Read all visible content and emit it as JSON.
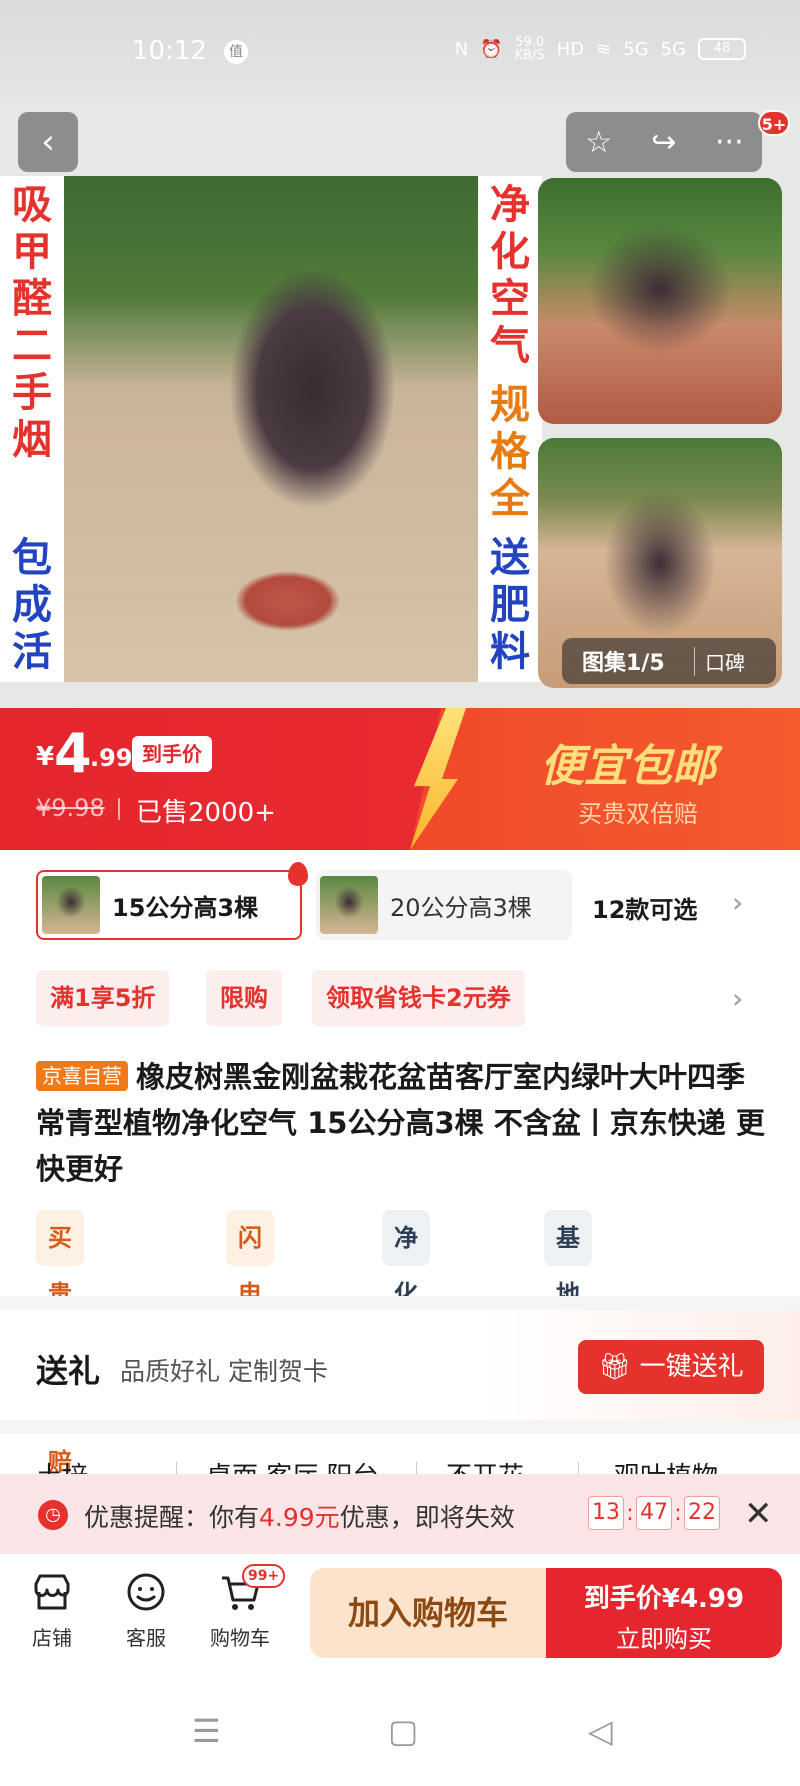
{
  "status_bar": {
    "time": "10:12",
    "app_badge": "值",
    "nfc": "N",
    "alarm": "⏰",
    "net_speed": "59.0\nKB/S",
    "hd": "HD",
    "wifi": "≋",
    "sig1": "5G",
    "sig2": "5G",
    "battery": "48"
  },
  "gallery": {
    "left_text_top": [
      "吸",
      "甲",
      "醛",
      "二",
      "手",
      "烟"
    ],
    "left_text_bottom": [
      "包",
      "成",
      "活"
    ],
    "right_text_top": [
      "净",
      "化",
      "空",
      "气"
    ],
    "right_text_mid": [
      "规",
      "格",
      "全"
    ],
    "right_text_bottom": [
      "送",
      "肥",
      "料"
    ],
    "counter": "图集1/5",
    "word_of_mouth": "口碑"
  },
  "nav": {
    "back": "‹",
    "star": "☆",
    "share": "↪",
    "more": "···",
    "badge": "5+"
  },
  "price": {
    "currency": "¥",
    "integer": "4",
    "decimal": ".99",
    "tag": "到手价",
    "original": "¥9.98",
    "sold": "已售2000+",
    "slogan": "便宜包邮",
    "slogan_sub": "买贵双倍赔"
  },
  "variants": {
    "items": [
      {
        "label": "15公分高3棵"
      },
      {
        "label": "20公分高3棵"
      }
    ],
    "more": "12款可选",
    "chevron": "›"
  },
  "promos": {
    "items": [
      "满1享5折",
      "限购",
      "领取省钱卡2元券"
    ],
    "chevron": "›"
  },
  "product": {
    "self_tag": "京喜自营",
    "title": "橡皮树黑金刚盆栽花盆苗客厅室内绿叶大叶四季常青型植物净化空气 15公分高3棵 不含盆丨京东快递 更快更好",
    "features": [
      "买贵双倍赔",
      "闪电退款",
      "净化空气",
      "基地直发"
    ]
  },
  "gift": {
    "title": "送礼",
    "subtitle": "品质好礼 定制贺卡",
    "button": "一键送礼"
  },
  "categories": [
    "土培",
    "桌面 客厅 阳台",
    "不开花",
    "观叶植物"
  ],
  "reminder": {
    "prefix": "优惠提醒：你有",
    "amount": "4.99元",
    "suffix": "优惠，即将失效",
    "timer": [
      "13",
      "47",
      "22"
    ],
    "close": "✕"
  },
  "bottom_bar": {
    "shop": "店铺",
    "service": "客服",
    "cart": "购物车",
    "cart_badge": "99+",
    "add_cart": "加入购物车",
    "buy_price": "到手价¥4.99",
    "buy_label": "立即购买"
  },
  "system_nav": {
    "menu": "☰",
    "home": "▢",
    "back": "◁"
  }
}
